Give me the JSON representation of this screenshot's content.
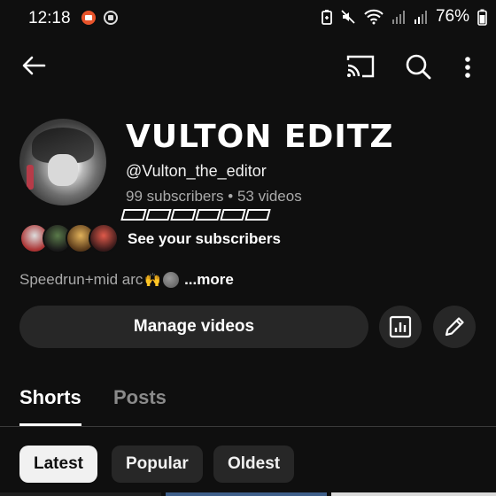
{
  "status_bar": {
    "time": "12:18",
    "battery": "76%",
    "icons": [
      "screen-record-icon",
      "media-icon",
      "battery-saver-icon",
      "mute-icon",
      "wifi-icon",
      "signal-icon",
      "signal-icon"
    ]
  },
  "toolbar": {
    "icons": [
      "back-arrow-icon",
      "cast-icon",
      "search-icon",
      "more-vert-icon"
    ]
  },
  "channel": {
    "name": "VULTON EDITZ",
    "handle": "@Vulton_the_editor",
    "stats": "99 subscribers • 53 videos",
    "see_subscribers": "See your subscribers",
    "description": "Speedrun+mid arc",
    "more": "...more"
  },
  "actions": {
    "manage_videos": "Manage videos",
    "analytics_icon": "analytics-icon",
    "edit_icon": "pencil-icon"
  },
  "tabs": [
    {
      "label": "Shorts",
      "active": true
    },
    {
      "label": "Posts",
      "active": false
    }
  ],
  "sort_chips": [
    {
      "label": "Latest",
      "selected": true
    },
    {
      "label": "Popular",
      "selected": false
    },
    {
      "label": "Oldest",
      "selected": false
    }
  ],
  "colors": {
    "background": "#0f0f0f",
    "surface": "#272727",
    "text_primary": "#f1f1f1",
    "text_secondary": "#aaaaaa"
  }
}
